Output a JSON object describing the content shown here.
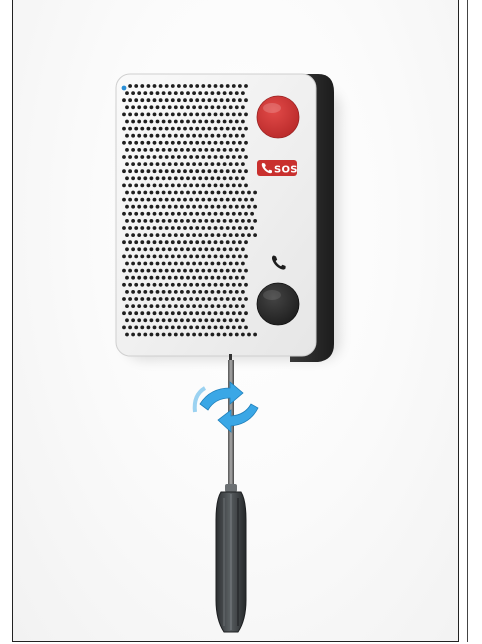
{
  "device": {
    "sos_label": "SOS",
    "emergency_button_color": "#d43636",
    "call_button_color": "#2b2b2b",
    "status_led_color": "#2a8fd6",
    "housing_side_color": "#2a2a2a"
  },
  "icons": {
    "sos_badge_icon": "phone-icon",
    "call_button_icon": "phone-icon",
    "rotation_indicator": "rotate-arrows-icon"
  },
  "tool": {
    "name_icon": "screwdriver-icon",
    "handle_color": "#3a3d3f",
    "rotation_arrow_color": "#3aa7e6"
  }
}
